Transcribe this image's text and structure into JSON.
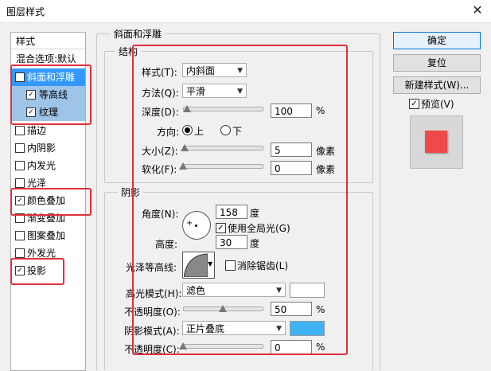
{
  "window": {
    "title": "图层样式",
    "close_glyph": "✕"
  },
  "sidebar": {
    "header": "样式",
    "items": [
      {
        "label": "混合选项:默认",
        "checkbox": false
      },
      {
        "label": "斜面和浮雕",
        "checkbox": true,
        "checked": true
      },
      {
        "label": "等高线",
        "checkbox": true,
        "checked": true
      },
      {
        "label": "纹理",
        "checkbox": true,
        "checked": true
      },
      {
        "label": "描边",
        "checkbox": true,
        "checked": false
      },
      {
        "label": "内阴影",
        "checkbox": true,
        "checked": false
      },
      {
        "label": "内发光",
        "checkbox": true,
        "checked": false
      },
      {
        "label": "光泽",
        "checkbox": true,
        "checked": false
      },
      {
        "label": "颜色叠加",
        "checkbox": true,
        "checked": true
      },
      {
        "label": "渐变叠加",
        "checkbox": true,
        "checked": false
      },
      {
        "label": "图案叠加",
        "checkbox": true,
        "checked": false
      },
      {
        "label": "外发光",
        "checkbox": true,
        "checked": false
      },
      {
        "label": "投影",
        "checkbox": true,
        "checked": true
      }
    ]
  },
  "bevel": {
    "section_title": "斜面和浮雕",
    "structure_title": "结构",
    "style_label": "样式(T):",
    "style_value": "内斜面",
    "method_label": "方法(Q):",
    "method_value": "平滑",
    "depth_label": "深度(D):",
    "depth_value": "100",
    "depth_unit": "%",
    "depth_level": 0.05,
    "direction_label": "方向:",
    "dir_up": "上",
    "dir_down": "下",
    "size_label": "大小(Z):",
    "size_value": "5",
    "size_unit": "像素",
    "size_level": 0.02,
    "soften_label": "软化(F):",
    "soften_value": "0",
    "soften_unit": "像素",
    "soften_level": 0.0
  },
  "shading": {
    "title": "阴影",
    "angle_label": "角度(N):",
    "angle_value": "158",
    "angle_unit": "度",
    "global_light_label": "使用全局光(G)",
    "altitude_label": "高度:",
    "altitude_value": "30",
    "altitude_unit": "度",
    "gloss_label": "光泽等高线:",
    "antialias_label": "消除锯齿(L)",
    "highlight_mode_label": "高光模式(H):",
    "highlight_mode_value": "滤色",
    "highlight_color": "#ffffff",
    "opacity1_label": "不透明度(O):",
    "opacity1_value": "50",
    "opacity1_unit": "%",
    "opacity1_level": 0.5,
    "shadow_mode_label": "阴影模式(A):",
    "shadow_mode_value": "正片叠底",
    "shadow_color": "#3fb3f3",
    "opacity2_label": "不透明度(C):",
    "opacity2_value": "0",
    "opacity2_unit": "%",
    "opacity2_level": 0.0
  },
  "buttons": {
    "ok": "确定",
    "reset": "复位",
    "new_style": "新建样式(W)...",
    "preview": "预览(V)"
  },
  "colors": {
    "highlight_red": "#e0303c",
    "selected": "#3399ff",
    "preview_swatch": "#ee4a4a"
  }
}
